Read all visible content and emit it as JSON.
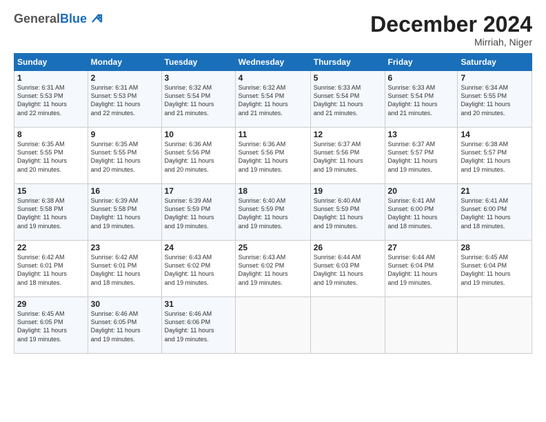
{
  "logo": {
    "general": "General",
    "blue": "Blue"
  },
  "title": "December 2024",
  "subtitle": "Mirriah, Niger",
  "days_header": [
    "Sunday",
    "Monday",
    "Tuesday",
    "Wednesday",
    "Thursday",
    "Friday",
    "Saturday"
  ],
  "weeks": [
    [
      {
        "day": "1",
        "sunrise": "6:31 AM",
        "sunset": "5:53 PM",
        "daylight": "11 hours and 22 minutes."
      },
      {
        "day": "2",
        "sunrise": "6:31 AM",
        "sunset": "5:53 PM",
        "daylight": "11 hours and 22 minutes."
      },
      {
        "day": "3",
        "sunrise": "6:32 AM",
        "sunset": "5:54 PM",
        "daylight": "11 hours and 21 minutes."
      },
      {
        "day": "4",
        "sunrise": "6:32 AM",
        "sunset": "5:54 PM",
        "daylight": "11 hours and 21 minutes."
      },
      {
        "day": "5",
        "sunrise": "6:33 AM",
        "sunset": "5:54 PM",
        "daylight": "11 hours and 21 minutes."
      },
      {
        "day": "6",
        "sunrise": "6:33 AM",
        "sunset": "5:54 PM",
        "daylight": "11 hours and 21 minutes."
      },
      {
        "day": "7",
        "sunrise": "6:34 AM",
        "sunset": "5:55 PM",
        "daylight": "11 hours and 20 minutes."
      }
    ],
    [
      {
        "day": "8",
        "sunrise": "6:35 AM",
        "sunset": "5:55 PM",
        "daylight": "11 hours and 20 minutes."
      },
      {
        "day": "9",
        "sunrise": "6:35 AM",
        "sunset": "5:55 PM",
        "daylight": "11 hours and 20 minutes."
      },
      {
        "day": "10",
        "sunrise": "6:36 AM",
        "sunset": "5:56 PM",
        "daylight": "11 hours and 20 minutes."
      },
      {
        "day": "11",
        "sunrise": "6:36 AM",
        "sunset": "5:56 PM",
        "daylight": "11 hours and 19 minutes."
      },
      {
        "day": "12",
        "sunrise": "6:37 AM",
        "sunset": "5:56 PM",
        "daylight": "11 hours and 19 minutes."
      },
      {
        "day": "13",
        "sunrise": "6:37 AM",
        "sunset": "5:57 PM",
        "daylight": "11 hours and 19 minutes."
      },
      {
        "day": "14",
        "sunrise": "6:38 AM",
        "sunset": "5:57 PM",
        "daylight": "11 hours and 19 minutes."
      }
    ],
    [
      {
        "day": "15",
        "sunrise": "6:38 AM",
        "sunset": "5:58 PM",
        "daylight": "11 hours and 19 minutes."
      },
      {
        "day": "16",
        "sunrise": "6:39 AM",
        "sunset": "5:58 PM",
        "daylight": "11 hours and 19 minutes."
      },
      {
        "day": "17",
        "sunrise": "6:39 AM",
        "sunset": "5:59 PM",
        "daylight": "11 hours and 19 minutes."
      },
      {
        "day": "18",
        "sunrise": "6:40 AM",
        "sunset": "5:59 PM",
        "daylight": "11 hours and 19 minutes."
      },
      {
        "day": "19",
        "sunrise": "6:40 AM",
        "sunset": "5:59 PM",
        "daylight": "11 hours and 19 minutes."
      },
      {
        "day": "20",
        "sunrise": "6:41 AM",
        "sunset": "6:00 PM",
        "daylight": "11 hours and 18 minutes."
      },
      {
        "day": "21",
        "sunrise": "6:41 AM",
        "sunset": "6:00 PM",
        "daylight": "11 hours and 18 minutes."
      }
    ],
    [
      {
        "day": "22",
        "sunrise": "6:42 AM",
        "sunset": "6:01 PM",
        "daylight": "11 hours and 18 minutes."
      },
      {
        "day": "23",
        "sunrise": "6:42 AM",
        "sunset": "6:01 PM",
        "daylight": "11 hours and 18 minutes."
      },
      {
        "day": "24",
        "sunrise": "6:43 AM",
        "sunset": "6:02 PM",
        "daylight": "11 hours and 19 minutes."
      },
      {
        "day": "25",
        "sunrise": "6:43 AM",
        "sunset": "6:02 PM",
        "daylight": "11 hours and 19 minutes."
      },
      {
        "day": "26",
        "sunrise": "6:44 AM",
        "sunset": "6:03 PM",
        "daylight": "11 hours and 19 minutes."
      },
      {
        "day": "27",
        "sunrise": "6:44 AM",
        "sunset": "6:04 PM",
        "daylight": "11 hours and 19 minutes."
      },
      {
        "day": "28",
        "sunrise": "6:45 AM",
        "sunset": "6:04 PM",
        "daylight": "11 hours and 19 minutes."
      }
    ],
    [
      {
        "day": "29",
        "sunrise": "6:45 AM",
        "sunset": "6:05 PM",
        "daylight": "11 hours and 19 minutes."
      },
      {
        "day": "30",
        "sunrise": "6:46 AM",
        "sunset": "6:05 PM",
        "daylight": "11 hours and 19 minutes."
      },
      {
        "day": "31",
        "sunrise": "6:46 AM",
        "sunset": "6:06 PM",
        "daylight": "11 hours and 19 minutes."
      },
      null,
      null,
      null,
      null
    ]
  ],
  "labels": {
    "sunrise": "Sunrise: ",
    "sunset": "Sunset: ",
    "daylight": "Daylight: "
  }
}
